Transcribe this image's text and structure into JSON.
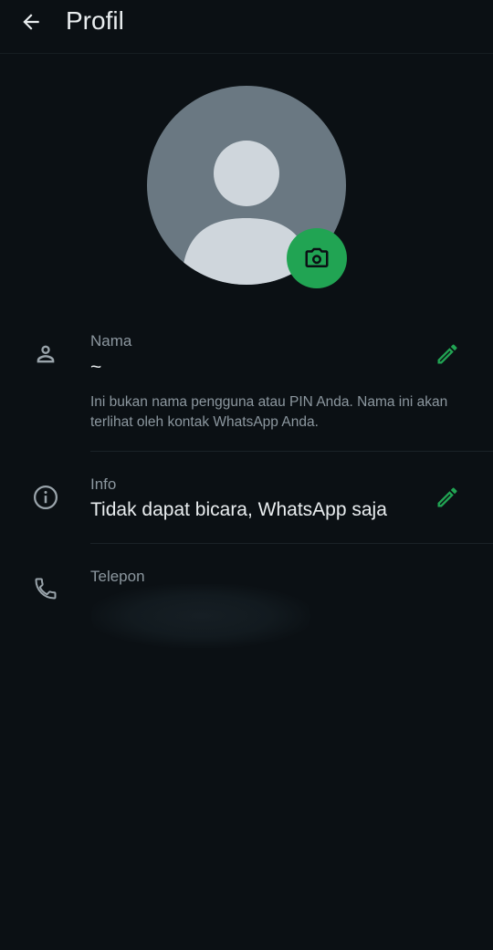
{
  "header": {
    "back_icon": "arrow-left-icon",
    "title": "Profil"
  },
  "avatar": {
    "placeholder_icon": "person-silhouette-icon",
    "camera_icon": "camera-icon",
    "accent_color": "#21a453"
  },
  "name_section": {
    "icon": "person-icon",
    "label": "Nama",
    "value": "~",
    "hint": "Ini bukan nama pengguna atau PIN Anda. Nama ini akan terlihat oleh kontak WhatsApp Anda.",
    "edit_icon": "pencil-icon"
  },
  "info_section": {
    "icon": "info-circle-icon",
    "label": "Info",
    "value": "Tidak dapat bicara, WhatsApp saja",
    "edit_icon": "pencil-icon"
  },
  "phone_section": {
    "icon": "phone-icon",
    "label": "Telepon"
  }
}
